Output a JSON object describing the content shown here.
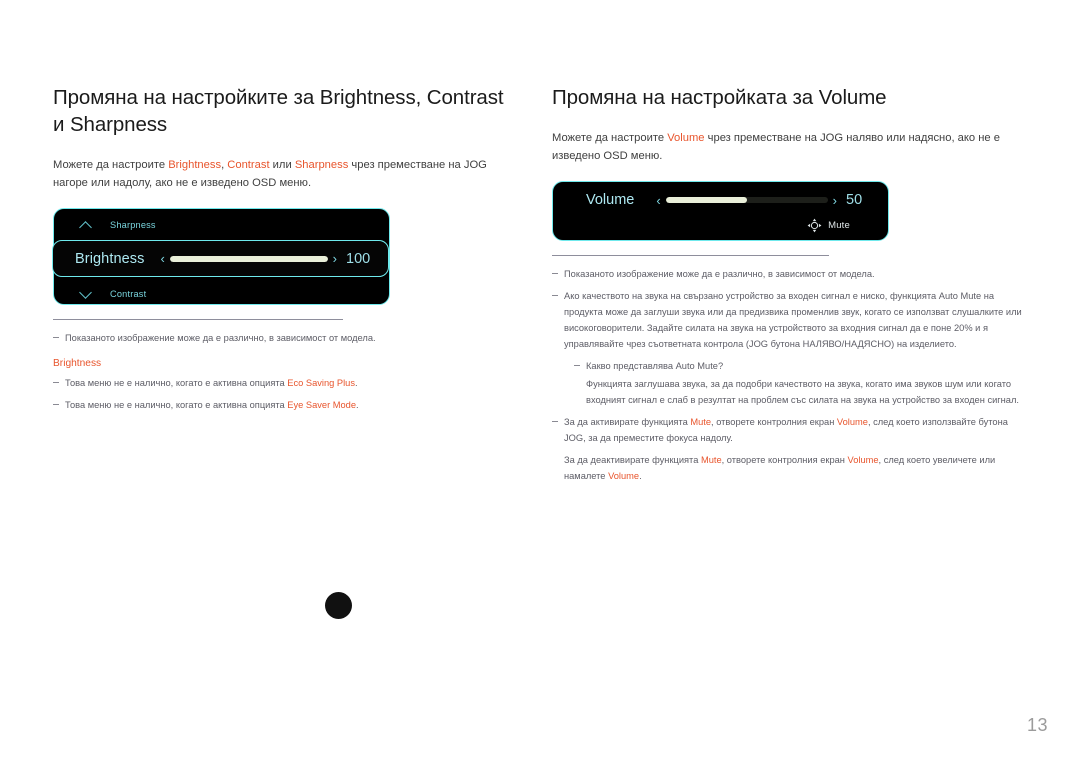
{
  "page": {
    "number": "13",
    "background": "#ffffff",
    "accent_highlight": "#e8552d",
    "osd_border": "#6fe9ec"
  },
  "left_column": {
    "heading": "Промяна на настройките за Brightness, Contrast и Sharpness",
    "intro": {
      "p1": "Можете да настроите ",
      "t1": "Brightness",
      "p2": ", ",
      "t2": "Contrast",
      "p3": " или ",
      "t3": "Sharpness",
      "p4": " чрез преместване на JOG нагоре или надолу, ако не е изведено OSD меню."
    },
    "osd": {
      "row_top_label": "Sharpness",
      "row_top_icon": "chevron-up-icon",
      "row_selected_label": "Brightness",
      "row_selected_value": "100",
      "row_selected_fill_percent": 100,
      "arrow_left": "‹",
      "arrow_right": "›",
      "row_bottom_label": "Contrast",
      "row_bottom_icon": "chevron-down-icon"
    },
    "notes": {
      "n1": "Показаното изображение може да е различно, в зависимост от модела.",
      "title": "Brightness",
      "n2_a": "Това меню не е налично, когато е активна опцията ",
      "n2_hl": "Eco Saving Plus",
      "n2_b": ".",
      "n3_a": "Това меню не е налично, когато е активна опцията ",
      "n3_hl": "Eye Saver Mode",
      "n3_b": "."
    }
  },
  "right_column": {
    "heading": "Промяна на настройката за Volume",
    "intro": {
      "p1": "Можете да настроите ",
      "t1": "Volume",
      "p2": " чрез преместване на JOG наляво или надясно, ако не е изведено OSD меню."
    },
    "osd": {
      "label": "Volume",
      "value": "50",
      "fill_percent": 50,
      "arrow_left": "‹",
      "arrow_right": "›",
      "mute_label": "Mute",
      "mute_icon": "jog-direction-icon"
    },
    "notes": {
      "n1": "Показаното изображение може да е различно, в зависимост от модела.",
      "n2": "Ако качеството на звука на свързано устройство за входен сигнал е ниско, функцията Auto Mute на продукта може да заглуши звука или да предизвика променлив звук, когато се използват слушалките или високоговорители. Задайте силата на звука на устройството за входния сигнал да е поне 20% и я управлявайте чрез съответната контрола (JOG бутона НАЛЯВО/НАДЯСНО) на изделието.",
      "n3": "Какво представлява Auto Mute?",
      "n3_body": "Функцията заглушава звука, за да подобри качеството на звука, когато има звуков шум или когато входният сигнал е слаб в резултат на проблем със силата на звука на устройство за входен сигнал.",
      "n4_a": "За да активирате функцията ",
      "n4_hl1": "Mute",
      "n4_b": ", отворете контролния екран ",
      "n4_hl2": "Volume",
      "n4_c": ", след което използвайте бутона JOG, за да преместите фокуса надолу.",
      "n5_a": "За да деактивирате функцията ",
      "n5_hl1": "Mute",
      "n5_b": ", отворете контролния екран ",
      "n5_hl2": "Volume",
      "n5_c": ", след което увеличете или намалете ",
      "n5_hl3": "Volume",
      "n5_d": "."
    }
  }
}
